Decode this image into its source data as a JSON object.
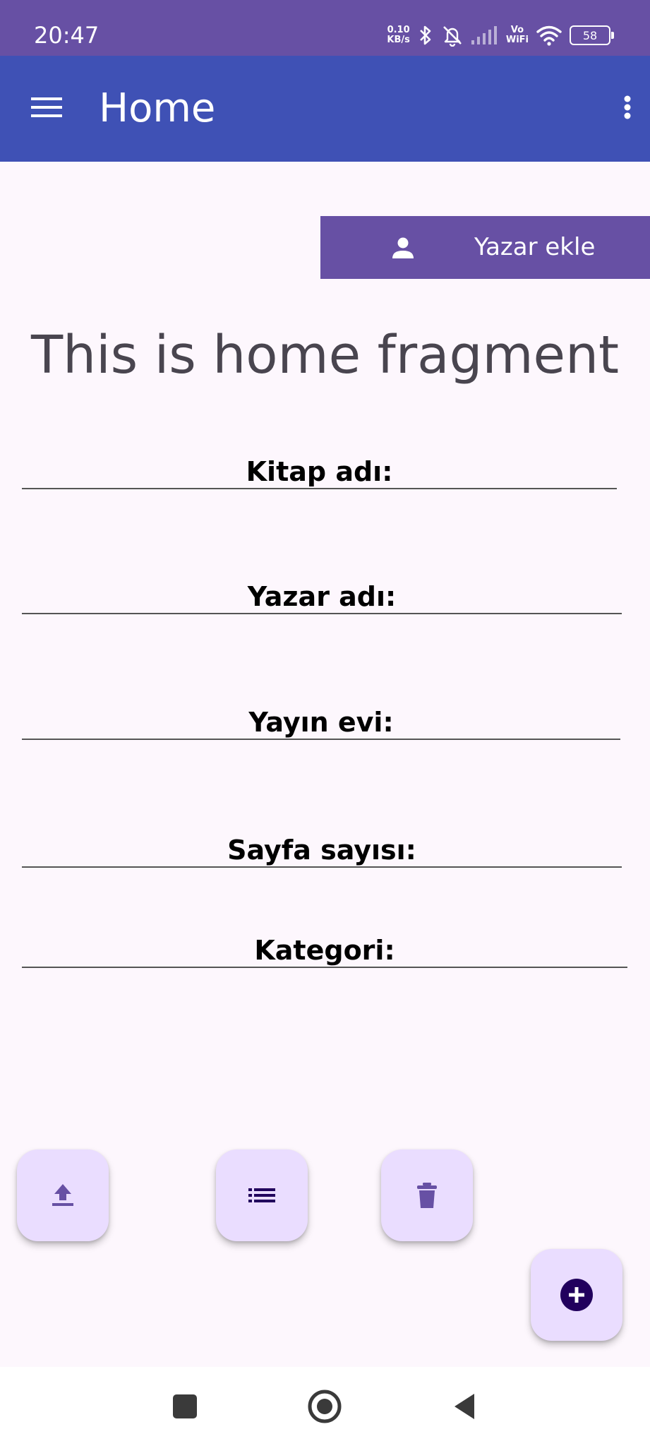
{
  "status_bar": {
    "time": "20:47",
    "net_speed_value": "0.10",
    "net_speed_unit": "KB/s",
    "vowifi_top": "Vo",
    "vowifi_bottom": "WiFi",
    "battery": "58",
    "icons": [
      "bluetooth-icon",
      "muted-bell-icon",
      "signal-icon",
      "wifi-icon",
      "battery-icon"
    ]
  },
  "app_bar": {
    "title": "Home",
    "menu_icon": "hamburger-menu-icon",
    "overflow_icon": "more-vert-icon",
    "color": "#3f51b5"
  },
  "add_author_button": {
    "label": "Yazar ekle",
    "icon": "person-icon",
    "color": "#6750a4"
  },
  "fragment_text": "This is home fragment",
  "form": {
    "book_name": {
      "placeholder": "Kitap adı:",
      "value": ""
    },
    "author_name": {
      "placeholder": "Yazar adı:",
      "value": ""
    },
    "publisher": {
      "placeholder": "Yayın evi:",
      "value": ""
    },
    "page_count": {
      "placeholder": "Sayfa sayısı:",
      "value": ""
    },
    "category": {
      "placeholder": "Kategori:",
      "value": ""
    }
  },
  "fabs": {
    "upload_icon": "upload-icon",
    "list_icon": "list-icon",
    "delete_icon": "trash-icon",
    "add_icon": "add-circle-icon",
    "color": "#eaddff"
  },
  "nav_bar": {
    "icons": [
      "recents-icon",
      "home-icon",
      "back-icon"
    ]
  }
}
